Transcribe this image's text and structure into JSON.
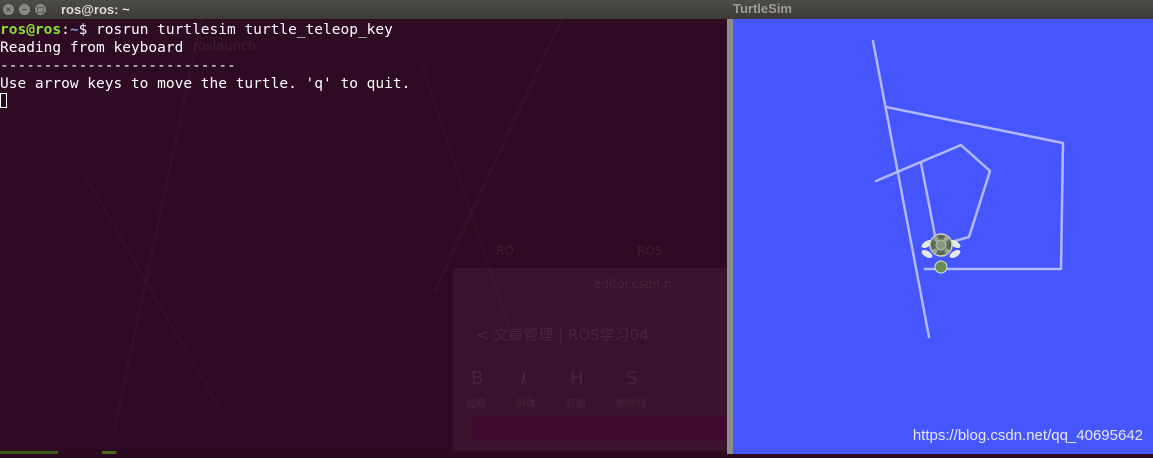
{
  "terminal": {
    "title": "ros@ros: ~",
    "window_buttons": [
      "×",
      "−",
      "□"
    ],
    "prompt_user": "ros@ros",
    "prompt_sep": ":",
    "prompt_path": "~",
    "prompt_dollar": "$ ",
    "command": "rosrun turtlesim turtle_teleop_key",
    "output_line1": "Reading from keyboard",
    "output_line2": "---------------------------",
    "output_line3": "Use arrow keys to move the turtle. 'q' to quit.",
    "ghost_texts": [
      "roslaunch",
      "RO",
      "ROS",
      "editor.csdn.n",
      "< 文章管理 | ROS学习04",
      "B",
      "I",
      "H",
      "S",
      "加粗",
      "斜体",
      "标题",
      "删除线"
    ]
  },
  "turtlesim": {
    "title": "TurtleSim",
    "background_color": "#4556ff",
    "pen_color": "#b3b8ff",
    "watermark": "https://blog.csdn.net/qq_40695642"
  }
}
